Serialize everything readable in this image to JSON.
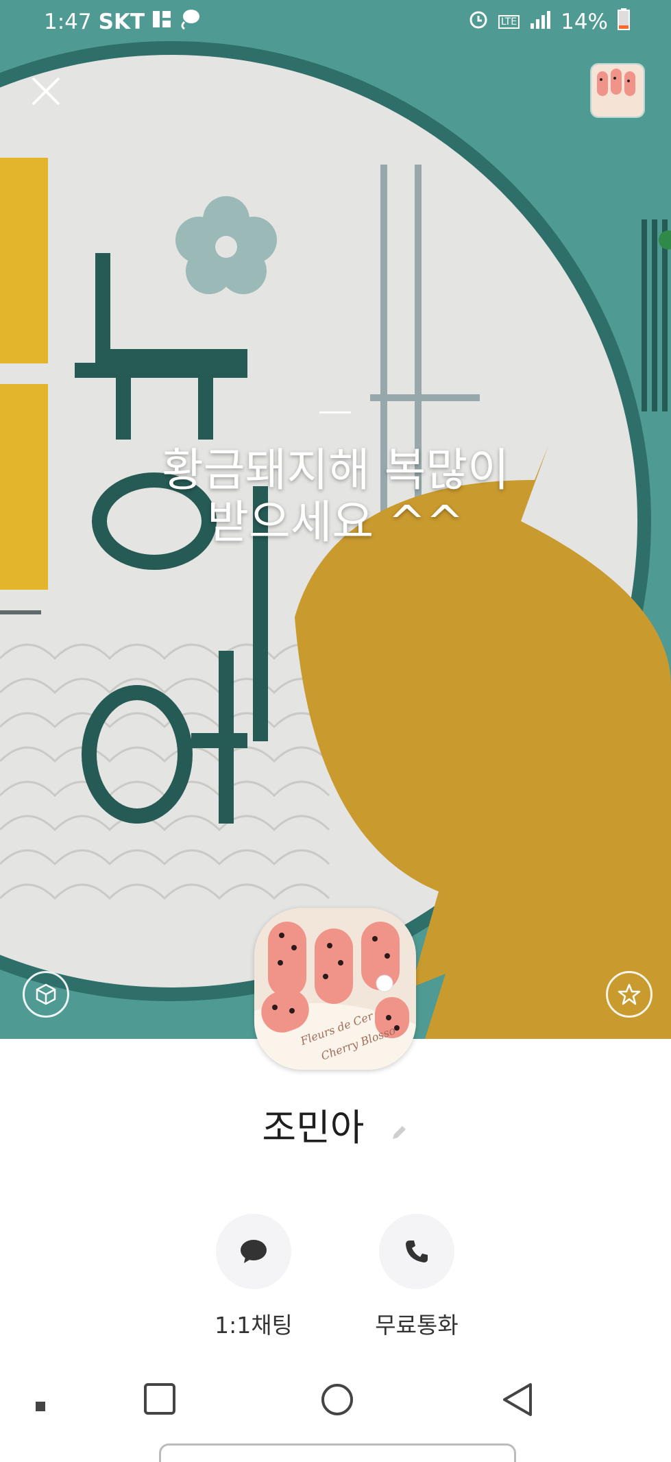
{
  "status_bar": {
    "time": "1:47",
    "carrier": "SKT",
    "battery": "14%",
    "network": "LTE",
    "icons": [
      "alarm-icon",
      "lte-icon",
      "signal-icon",
      "battery-icon"
    ]
  },
  "profile": {
    "status_message_line1": "황금돼지해 복많이",
    "status_message_line2": "받으세요 ^^",
    "name": "조민아"
  },
  "actions": [
    {
      "label": "1:1채팅",
      "icon": "chat-bubble-icon"
    },
    {
      "label": "무료통화",
      "icon": "phone-icon"
    }
  ],
  "colors": {
    "background_teal": "#4f9b93",
    "gold": "#c99a2e",
    "nail_pink": "#f0948a"
  }
}
